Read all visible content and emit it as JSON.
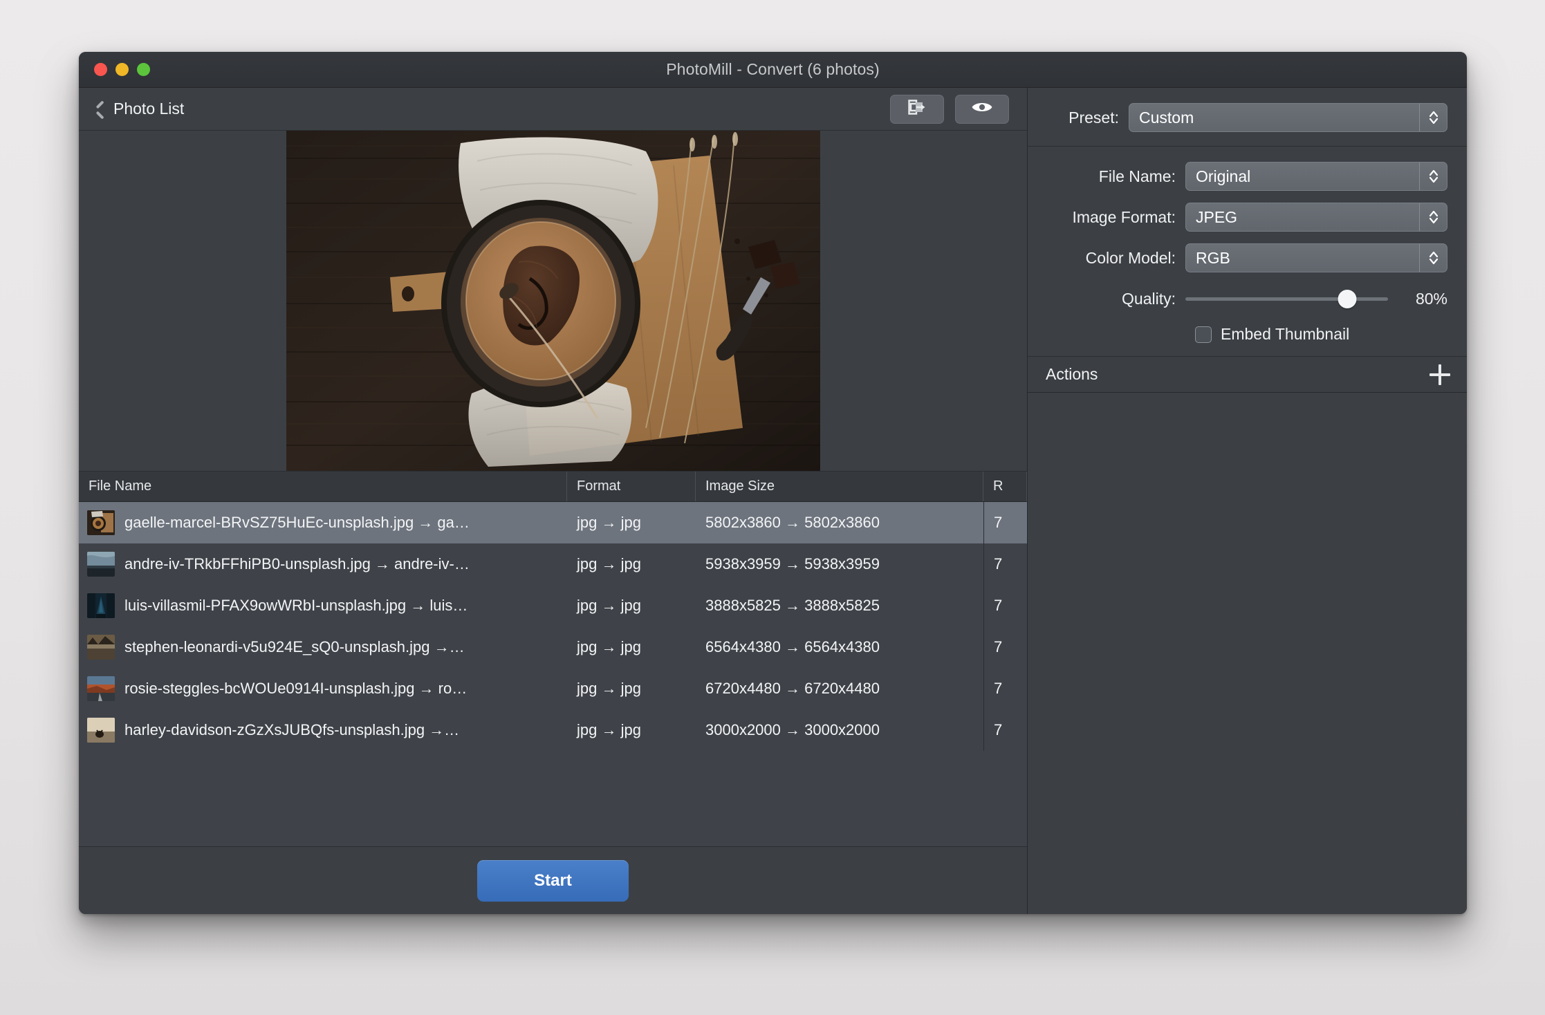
{
  "window": {
    "title": "PhotoMill - Convert (6 photos)",
    "traffic_lights": [
      "close",
      "minimize",
      "zoom"
    ],
    "colors": {
      "close": "#f9564f",
      "minimize": "#f0b726",
      "zoom": "#5cc53c",
      "accent": "#3d72bd",
      "panel": "#3c4045",
      "selection": "#6d747e"
    }
  },
  "toolbar": {
    "back_label": "Photo List",
    "back_icon": "chevron-left-icon",
    "buttons": [
      {
        "icon": "export-to-folder-icon",
        "name": "reveal-in-finder-button"
      },
      {
        "icon": "eye-icon",
        "name": "preview-button"
      }
    ]
  },
  "preview": {
    "alt": "Chocolate lava cake in a dark cast-iron skillet on a wooden cutting board with linen cloth"
  },
  "table": {
    "headers": [
      "File Name",
      "Format",
      "Image Size",
      "R"
    ],
    "rows": [
      {
        "thumb": "food-skillet-thumb",
        "file_name": "gaelle-marcel-BRvSZ75HuEc-unsplash.jpg → ga…",
        "format": "jpg → jpg",
        "image_size": "5802x3860 → 5802x3860",
        "resolution": "7",
        "selected": true
      },
      {
        "thumb": "stormy-sea-thumb",
        "file_name": "andre-iv-TRkbFFhiPB0-unsplash.jpg → andre-iv-…",
        "format": "jpg → jpg",
        "image_size": "5938x3959 → 5938x3959",
        "resolution": "7",
        "selected": false
      },
      {
        "thumb": "night-tower-thumb",
        "file_name": "luis-villasmil-PFAX9owWRbI-unsplash.jpg → luis…",
        "format": "jpg → jpg",
        "image_size": "3888x5825 → 3888x5825",
        "resolution": "7",
        "selected": false
      },
      {
        "thumb": "mountain-lake-thumb",
        "file_name": "stephen-leonardi-v5u924E_sQ0-unsplash.jpg →…",
        "format": "jpg → jpg",
        "image_size": "6564x4380 → 6564x4380",
        "resolution": "7",
        "selected": false
      },
      {
        "thumb": "desert-road-thumb",
        "file_name": "rosie-steggles-bcWOUe0914I-unsplash.jpg → ro…",
        "format": "jpg → jpg",
        "image_size": "6720x4480 → 6720x4480",
        "resolution": "7",
        "selected": false
      },
      {
        "thumb": "motorcycle-sunset-thumb",
        "file_name": "harley-davidson-zGzXsJUBQfs-unsplash.jpg →…",
        "format": "jpg → jpg",
        "image_size": "3000x2000 → 3000x2000",
        "resolution": "7",
        "selected": false
      }
    ]
  },
  "footer": {
    "start_label": "Start"
  },
  "settings": {
    "preset": {
      "label": "Preset:",
      "value": "Custom"
    },
    "file_name": {
      "label": "File Name:",
      "value": "Original"
    },
    "image_format": {
      "label": "Image Format:",
      "value": "JPEG"
    },
    "color_model": {
      "label": "Color Model:",
      "value": "RGB"
    },
    "quality": {
      "label": "Quality:",
      "value": "80%",
      "percent": 80
    },
    "embed_thumbnail": {
      "label": "Embed Thumbnail",
      "checked": false
    }
  },
  "actions": {
    "title": "Actions",
    "add_icon": "plus-icon",
    "items": []
  }
}
